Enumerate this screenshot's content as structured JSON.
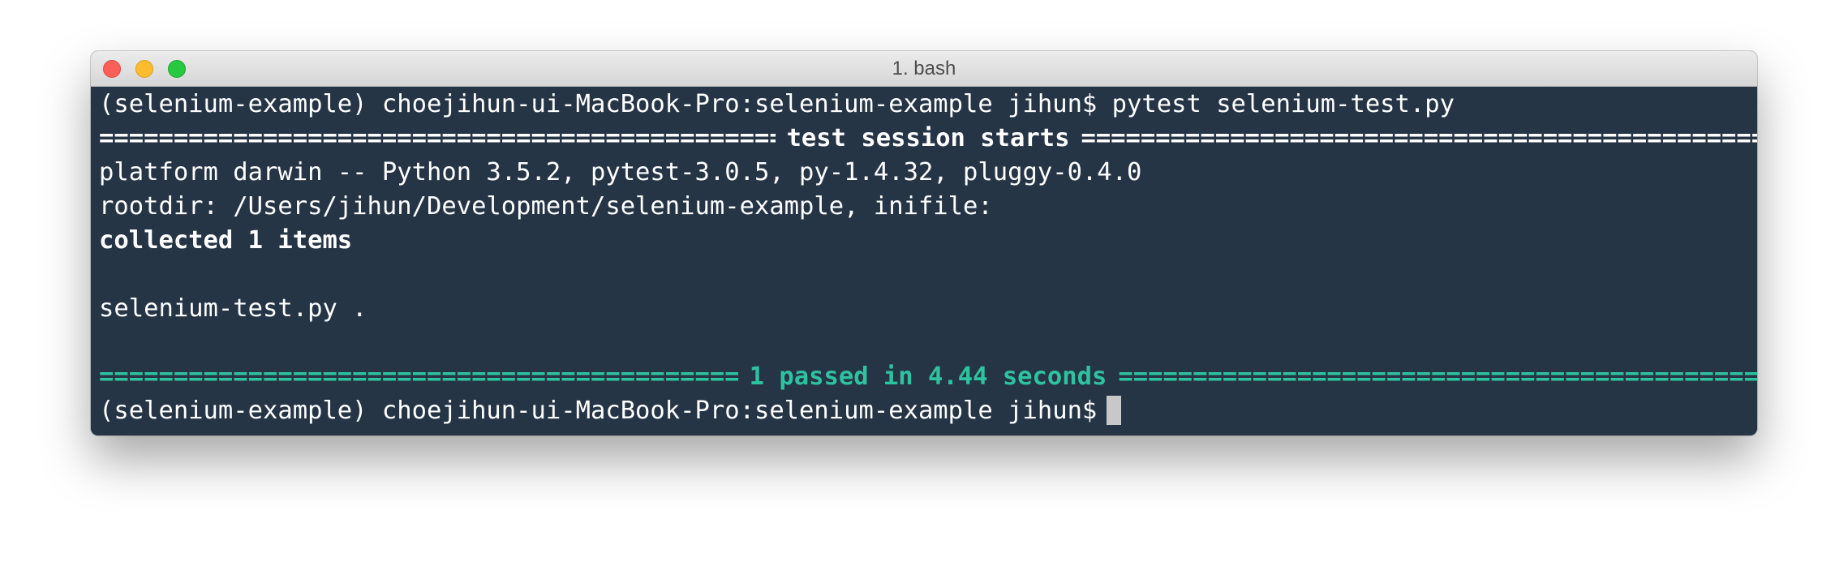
{
  "window": {
    "title": "1. bash",
    "colors": {
      "terminal_bg": "#263546",
      "text": "#ffffff",
      "success": "#2fc29f",
      "close": "#fc5f57",
      "minimize": "#fdbc2e",
      "zoom": "#28c840"
    }
  },
  "terminal": {
    "command_line": "(selenium-example) choejihun-ui-MacBook-Pro:selenium-example jihun$ pytest selenium-test.py",
    "session_separator": {
      "label": "test session starts"
    },
    "platform_line": "platform darwin -- Python 3.5.2, pytest-3.0.5, py-1.4.32, pluggy-0.4.0",
    "rootdir_line": "rootdir: /Users/jihun/Development/selenium-example, inifile:",
    "collected_line": "collected 1 items",
    "test_result_line": "selenium-test.py .",
    "summary_separator": {
      "label": "1 passed in 4.44 seconds"
    },
    "prompt_line": "(selenium-example) choejihun-ui-MacBook-Pro:selenium-example jihun$"
  },
  "icons": {
    "close": "close-traffic-light-icon",
    "minimize": "minimize-traffic-light-icon",
    "zoom": "zoom-traffic-light-icon"
  }
}
